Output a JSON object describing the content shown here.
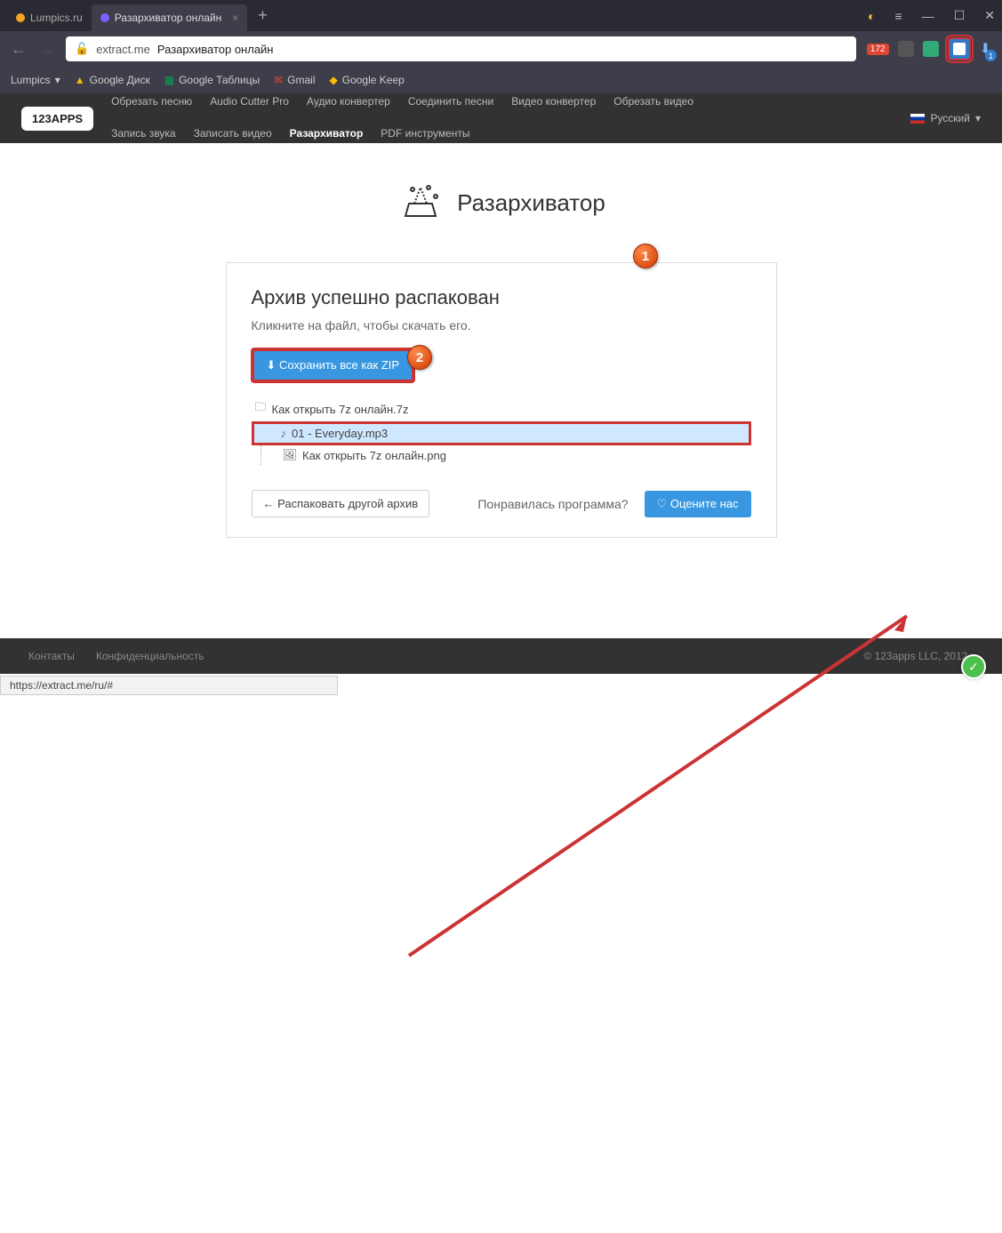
{
  "browser": {
    "tabs": [
      {
        "title": "Lumpics.ru",
        "color": "#f5a623"
      },
      {
        "title": "Разархиватор онлайн",
        "color": "#7b61ff"
      }
    ],
    "address": {
      "domain": "extract.me",
      "rest": "Разархиватор онлайн"
    },
    "extBadge": "172",
    "downloadCount": "1"
  },
  "bookmarks": [
    "Lumpics",
    "Google Диск",
    "Google Таблицы",
    "Gmail",
    "Google Keep"
  ],
  "nav": {
    "logo": "123APPS",
    "links": [
      "Обрезать песню",
      "Audio Cutter Pro",
      "Аудио конвертер",
      "Соединить песни",
      "Видео конвертер",
      "Обрезать видео",
      "Запись звука",
      "Записать видео",
      "Разархиватор",
      "PDF инструменты"
    ],
    "activeIndex": 8,
    "lang": "Русский"
  },
  "page": {
    "heroTitle": "Разархиватор",
    "heading": "Архив успешно распакован",
    "subtitle": "Кликните на файл, чтобы скачать его.",
    "saveZip": "Сохранить все как ZIP",
    "tree": {
      "root": "Как открыть 7z онлайн.7z",
      "items": [
        "01 - Everyday.mp3",
        "Как открыть 7z онлайн.png"
      ]
    },
    "anotherBtn": "Распаковать другой архив",
    "likeText": "Понравилась программа?",
    "rateBtn": "Оцените нас"
  },
  "footer": {
    "links": [
      "Контакты",
      "Конфиденциальность"
    ],
    "copyright": "© 123apps LLC, 2012–"
  },
  "statusbar": "https://extract.me/ru/#",
  "callouts": {
    "one": "1",
    "two": "2"
  }
}
